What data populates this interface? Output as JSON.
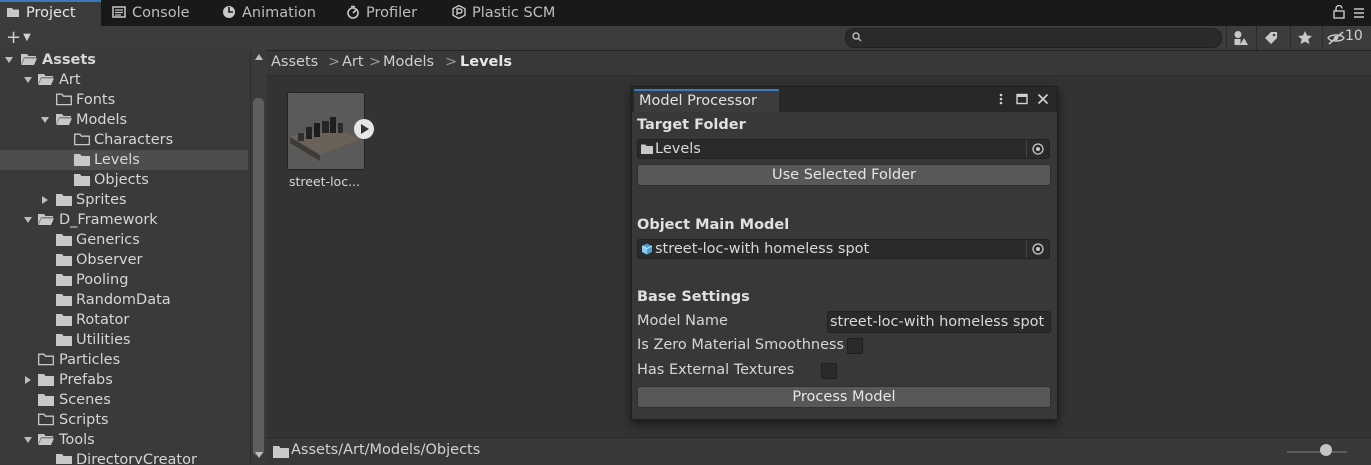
{
  "tabs": [
    {
      "label": "Project",
      "icon": "folder-icon",
      "active": true
    },
    {
      "label": "Console",
      "icon": "console-icon",
      "active": false
    },
    {
      "label": "Animation",
      "icon": "animation-icon",
      "active": false
    },
    {
      "label": "Profiler",
      "icon": "profiler-icon",
      "active": false
    },
    {
      "label": "Plastic SCM",
      "icon": "plastic-scm-icon",
      "active": false
    }
  ],
  "toolbar": {
    "add_label": "+",
    "search_value": "",
    "hidden_count": "10"
  },
  "tree": {
    "items": [
      {
        "label": "Assets",
        "bold": true
      },
      {
        "label": "Art"
      },
      {
        "label": "Fonts"
      },
      {
        "label": "Models"
      },
      {
        "label": "Characters"
      },
      {
        "label": "Levels",
        "selected": true
      },
      {
        "label": "Objects"
      },
      {
        "label": "Sprites"
      },
      {
        "label": "D_Framework"
      },
      {
        "label": "Generics"
      },
      {
        "label": "Observer"
      },
      {
        "label": "Pooling"
      },
      {
        "label": "RandomData"
      },
      {
        "label": "Rotator"
      },
      {
        "label": "Utilities"
      },
      {
        "label": "Particles"
      },
      {
        "label": "Prefabs"
      },
      {
        "label": "Scenes"
      },
      {
        "label": "Scripts"
      },
      {
        "label": "Tools"
      },
      {
        "label": "DirectoryCreator"
      }
    ]
  },
  "breadcrumb": {
    "items": [
      "Assets",
      "Art",
      "Models",
      "Levels"
    ],
    "separator": ">"
  },
  "assets": [
    {
      "label": "street-loc...",
      "type": "model"
    }
  ],
  "status": {
    "path": "Assets/Art/Models/Objects"
  },
  "model_processor": {
    "title": "Model Processor",
    "target_folder_label": "Target Folder",
    "target_folder_value": "Levels",
    "use_selected_folder_label": "Use Selected Folder",
    "object_main_model_label": "Object Main Model",
    "object_main_model_value": "street-loc-with homeless spot",
    "base_settings_label": "Base Settings",
    "model_name_label": "Model Name",
    "model_name_value": "street-loc-with homeless spot",
    "zero_smoothness_label": "Is Zero Material Smoothness",
    "zero_smoothness_checked": false,
    "external_textures_label": "Has External Textures",
    "external_textures_checked": false,
    "process_model_label": "Process Model"
  },
  "colors": {
    "accent": "#3a79bb",
    "panel_bg": "#383838",
    "tab_bg": "#191919"
  }
}
